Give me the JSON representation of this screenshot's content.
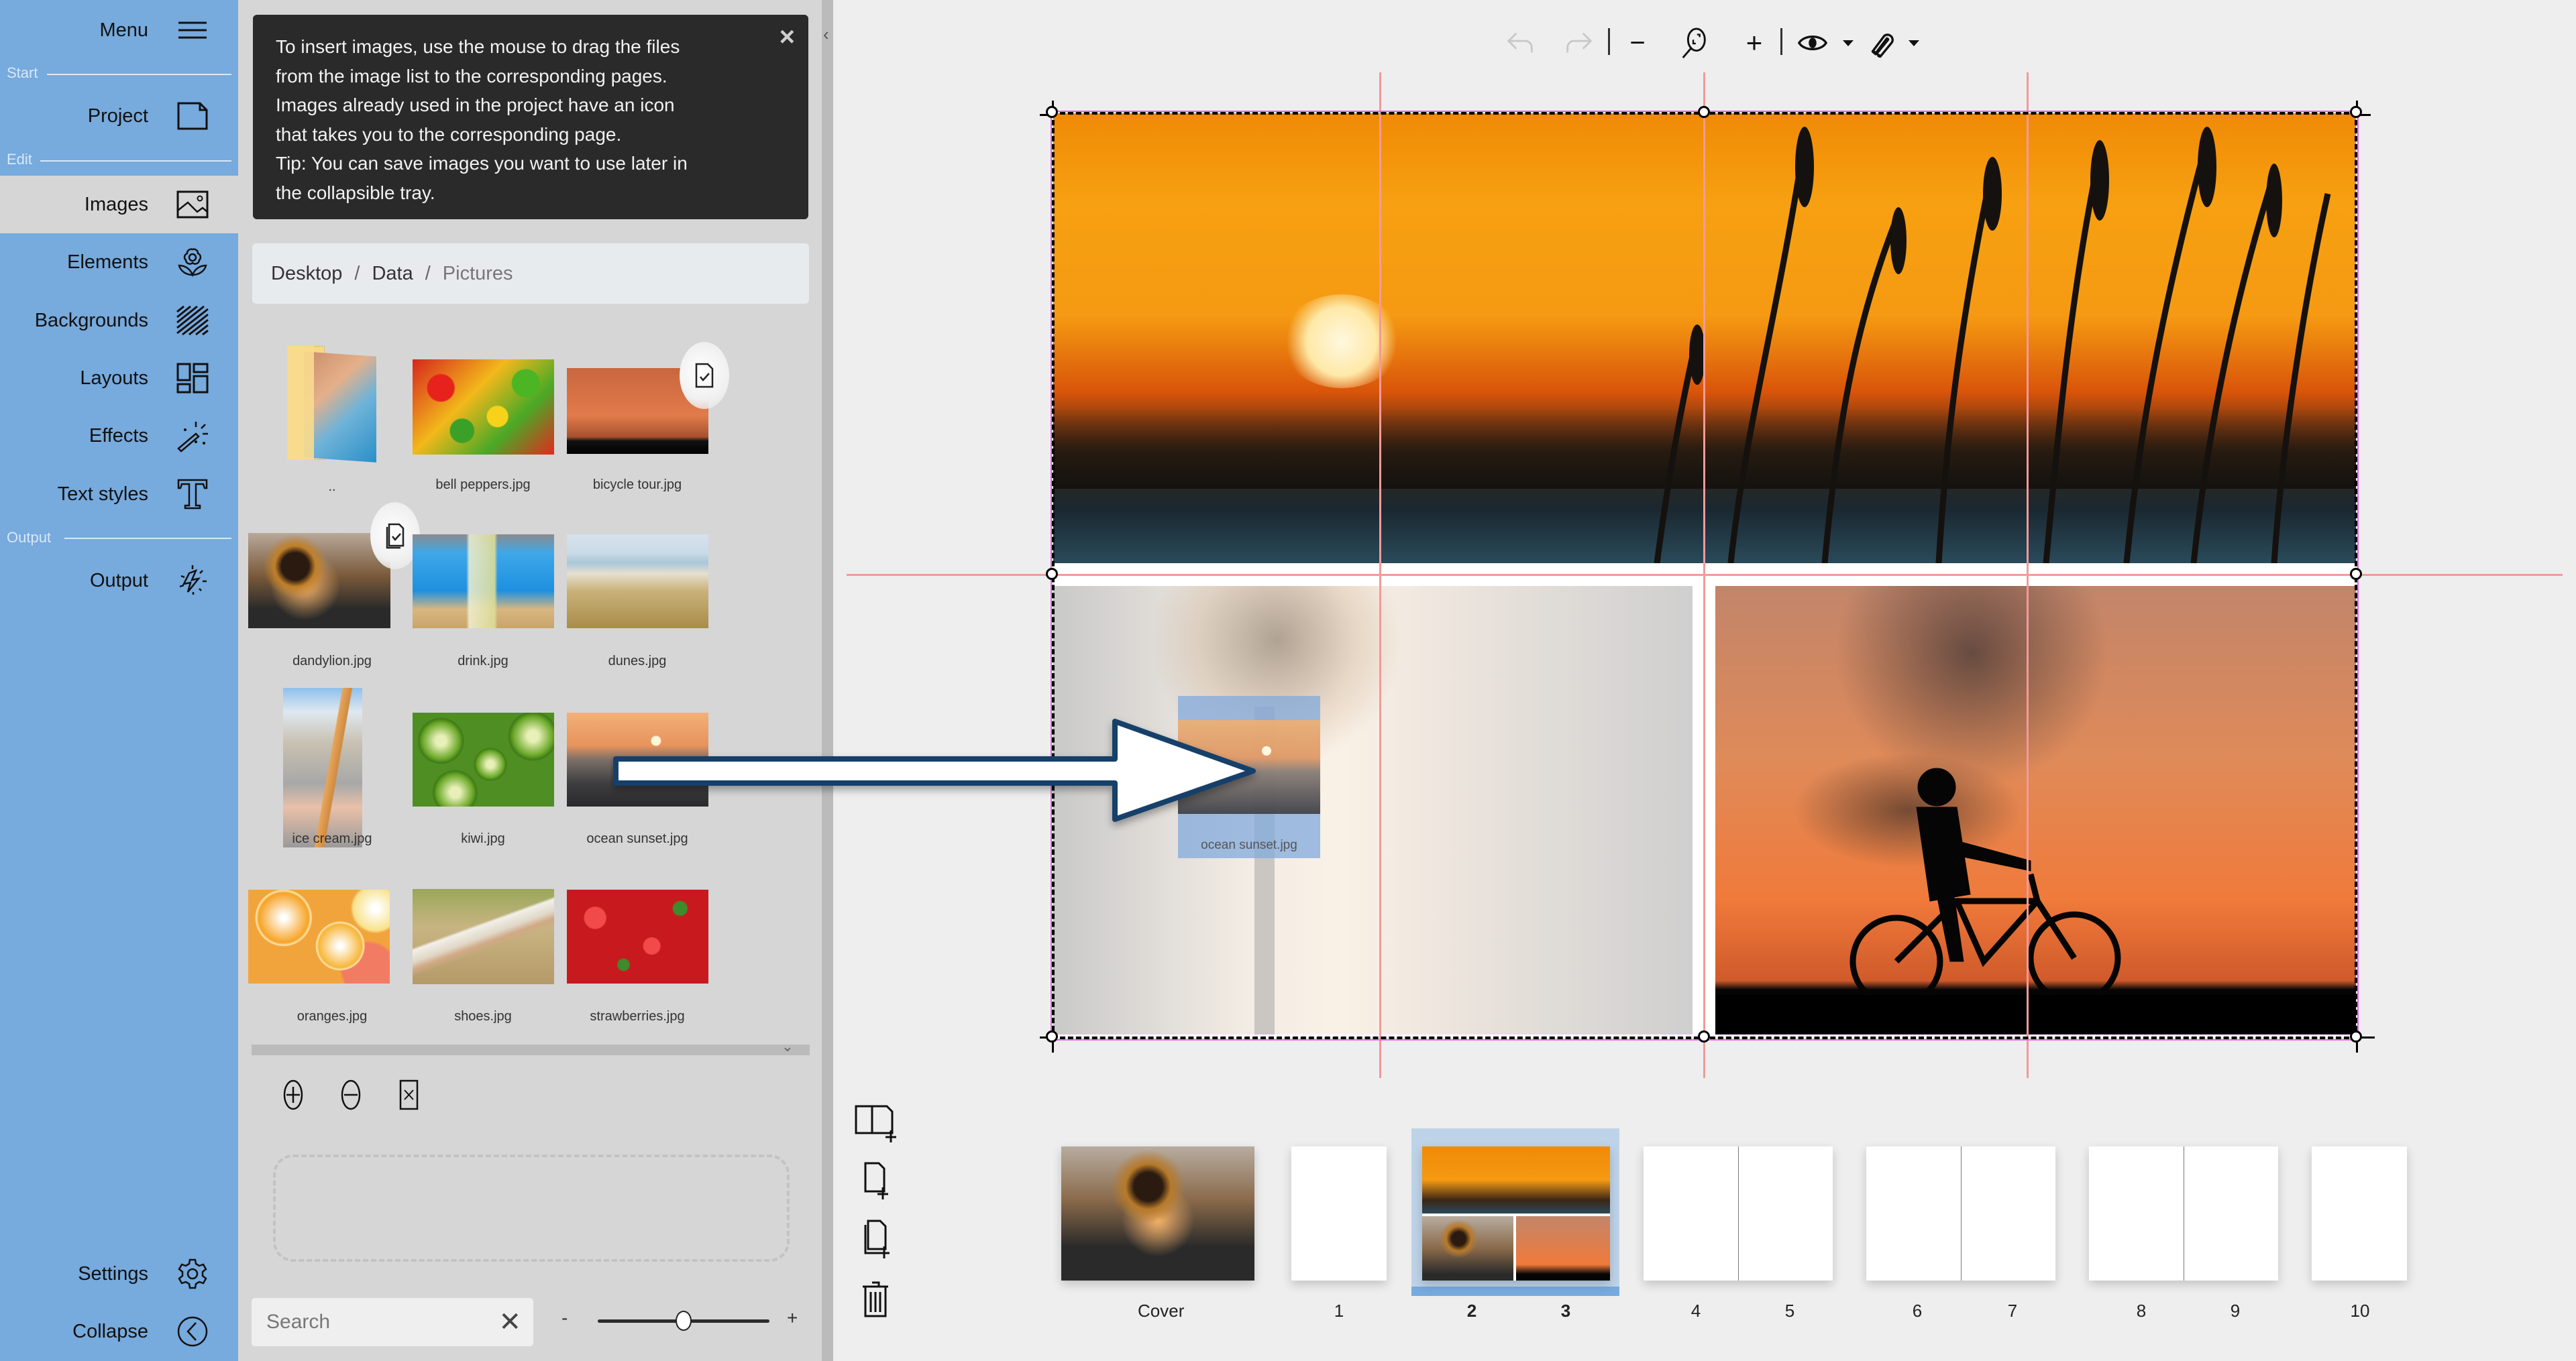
{
  "sidebar": {
    "menu_label": "Menu",
    "sections": {
      "start": "Start",
      "edit": "Edit",
      "output": "Output"
    },
    "items": [
      {
        "label": "Project",
        "icon": "document-icon"
      },
      {
        "label": "Images",
        "icon": "image-icon",
        "active": true
      },
      {
        "label": "Elements",
        "icon": "flower-icon"
      },
      {
        "label": "Backgrounds",
        "icon": "hatch-pattern-icon"
      },
      {
        "label": "Layouts",
        "icon": "layout-grid-icon"
      },
      {
        "label": "Effects",
        "icon": "magic-wand-icon"
      },
      {
        "label": "Text styles",
        "icon": "text-t-icon"
      },
      {
        "label": "Output",
        "icon": "burst-output-icon"
      }
    ],
    "settings_label": "Settings",
    "collapse_label": "Collapse"
  },
  "tip": {
    "lines": [
      "To insert images, use the mouse to drag the files",
      "from the image list to the corresponding pages.",
      "Images already used in the project have an icon",
      "that takes you to the corresponding page.",
      "Tip: You can save images you want to use later in",
      "the collapsible tray."
    ],
    "close": "×"
  },
  "breadcrumb": {
    "items": [
      "Desktop",
      "Data",
      "Pictures"
    ],
    "separator": "/"
  },
  "images": [
    {
      "name": "..",
      "kind": "parent-folder"
    },
    {
      "name": "bell peppers.jpg",
      "used": false
    },
    {
      "name": "bicycle tour.jpg",
      "used": true
    },
    {
      "name": "dandylion.jpg",
      "used": true
    },
    {
      "name": "drink.jpg",
      "used": false
    },
    {
      "name": "dunes.jpg",
      "used": false
    },
    {
      "name": "ice cream.jpg",
      "used": false
    },
    {
      "name": "kiwi.jpg",
      "used": false
    },
    {
      "name": "ocean sunset.jpg",
      "used": false
    },
    {
      "name": "oranges.jpg",
      "used": false
    },
    {
      "name": "shoes.jpg",
      "used": false
    },
    {
      "name": "strawberries.jpg",
      "used": false
    }
  ],
  "tray": {
    "add": "add-to-tray",
    "remove": "remove-from-tray",
    "clear": "clear-tray"
  },
  "search": {
    "placeholder": "Search",
    "value": ""
  },
  "thumb_size_slider": {
    "minus": "-",
    "plus": "+",
    "value_fraction": 0.5
  },
  "toolbar": {
    "undo_enabled": false,
    "redo_enabled": false,
    "zoom_out": "−",
    "zoom_in": "+"
  },
  "drag": {
    "file": "ocean sunset.jpg",
    "target": "page 2 bottom-left frame"
  },
  "pages": [
    {
      "label": "Cover",
      "type": "single"
    },
    {
      "label": "1",
      "type": "single"
    },
    {
      "labels": [
        "2",
        "3"
      ],
      "type": "spread",
      "selected": true
    },
    {
      "labels": [
        "4",
        "5"
      ],
      "type": "spread"
    },
    {
      "labels": [
        "6",
        "7"
      ],
      "type": "spread"
    },
    {
      "labels": [
        "8",
        "9"
      ],
      "type": "spread"
    },
    {
      "label": "10",
      "type": "single"
    }
  ],
  "colors": {
    "sidebar": "#77aadd",
    "panel": "#d6d6d6",
    "canvas": "#eeeeee",
    "tip_bg": "#2a2a2a",
    "guide": "#f39a9a",
    "arrow_stroke": "#123f6a",
    "selection": "#bed3e8"
  }
}
